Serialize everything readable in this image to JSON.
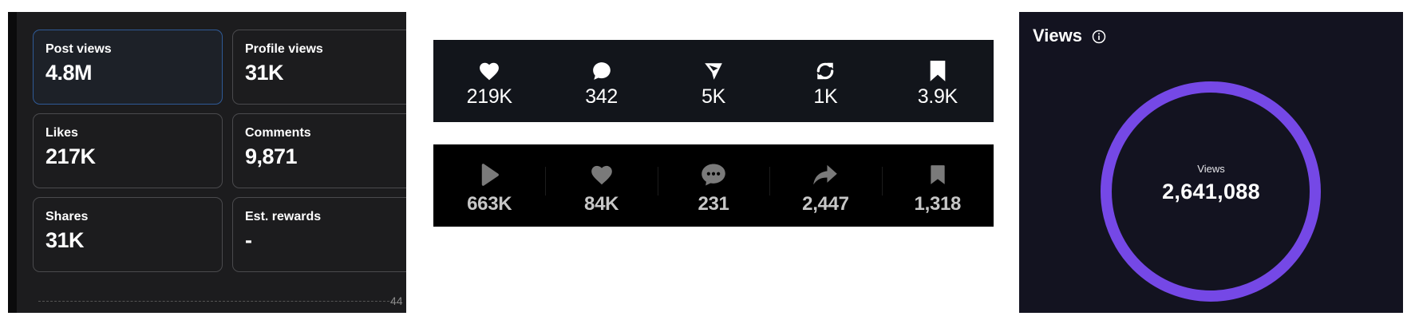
{
  "analytics": {
    "cards": [
      {
        "label": "Post views",
        "value": "4.8M"
      },
      {
        "label": "Profile views",
        "value": "31K"
      },
      {
        "label": "Likes",
        "value": "217K"
      },
      {
        "label": "Comments",
        "value": "9,871"
      },
      {
        "label": "Shares",
        "value": "31K"
      },
      {
        "label": "Est. rewards",
        "value": "-"
      }
    ],
    "axis_label": "44"
  },
  "stats_bar_1": [
    {
      "icon": "heart-icon",
      "value": "219K"
    },
    {
      "icon": "comment-icon",
      "value": "342"
    },
    {
      "icon": "send-icon",
      "value": "5K"
    },
    {
      "icon": "repost-icon",
      "value": "1K"
    },
    {
      "icon": "bookmark-icon",
      "value": "3.9K"
    }
  ],
  "stats_bar_2": [
    {
      "icon": "play-icon",
      "value": "663K"
    },
    {
      "icon": "heart-icon",
      "value": "84K"
    },
    {
      "icon": "comment-dots-icon",
      "value": "231"
    },
    {
      "icon": "share-arrow-icon",
      "value": "2,447"
    },
    {
      "icon": "bookmark-icon",
      "value": "1,318"
    }
  ],
  "views_panel": {
    "title": "Views",
    "ring_label": "Views",
    "ring_value": "2,641,088",
    "ring_color": "#7548e6"
  },
  "colors": {
    "card_active_border": "#2f5a96",
    "panel_dark": "#1c1c1e"
  }
}
